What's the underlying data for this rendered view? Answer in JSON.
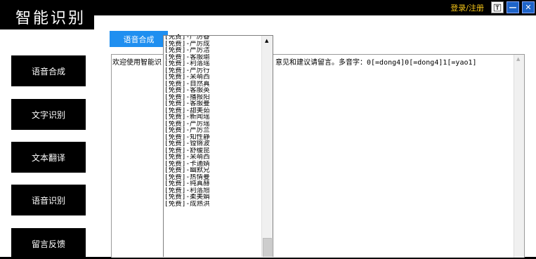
{
  "app": {
    "title": "智能识别"
  },
  "window_controls": {
    "login": "登录/注册",
    "skin": "🅃",
    "minimize": "—",
    "close": "✕"
  },
  "nav": [
    {
      "label": "语音合成"
    },
    {
      "label": "文字识别"
    },
    {
      "label": "文本翻译"
    },
    {
      "label": "语音识别"
    },
    {
      "label": "留言反馈"
    }
  ],
  "tab": {
    "label": "语音合成"
  },
  "textarea": {
    "text_start": "欢迎使用智能识",
    "text_end": "意见和建议请留言。多音字：0[=dong4]0[=dong4]1[=yao1]"
  },
  "voice_list": [
    "[免费]-严厉睿",
    "[免费]-严厉成",
    "[免费]-严厉洁",
    "[免费]-客服瑜",
    "[免费]-利落瑶",
    "[免费]-严厉行",
    "[免费]-呆萌西",
    "[免费]-自然真",
    "[免费]-客服英",
    "[免费]-播报阳",
    "[免费]-客服曼",
    "[免费]-甜美茹",
    "[免费]-新闻瑶",
    "[免费]-严厉瑶",
    "[免费]-严厉兰",
    "[免费]-知性静",
    "[免费]-镗锵波",
    "[免费]-舒缓昆",
    "[免费]-呆萌西",
    "[免费]-卡通婧",
    "[免费]-幽默兄",
    "[免费]-热情曼",
    "[免费]-纯真赫",
    "[免费]-利落旭",
    "[免费]-柔美娟",
    "[免费]-成熟洪"
  ]
}
